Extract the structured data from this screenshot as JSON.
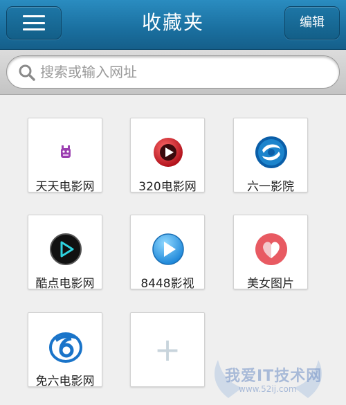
{
  "header": {
    "title": "收藏夹",
    "edit_label": "编辑"
  },
  "search": {
    "placeholder": "搜索或输入网址"
  },
  "bookmarks": [
    {
      "label": "天天电影网",
      "icon": "tiantian-logo-icon"
    },
    {
      "label": "320电影网",
      "icon": "red-play-icon"
    },
    {
      "label": "六一影院",
      "icon": "blue-swirl-icon"
    },
    {
      "label": "酷点电影网",
      "icon": "dark-play-icon"
    },
    {
      "label": "8448影视",
      "icon": "blue-play-icon"
    },
    {
      "label": "美女图片",
      "icon": "red-heart-icon"
    },
    {
      "label": "免六电影网",
      "icon": "blue-six-icon"
    }
  ],
  "add_tile": {
    "symbol": "+"
  },
  "watermark": {
    "text": "我爱IT技术网",
    "url": "www.52ij.com"
  },
  "colors": {
    "header": "#1a6f9f",
    "background": "#efefef"
  }
}
